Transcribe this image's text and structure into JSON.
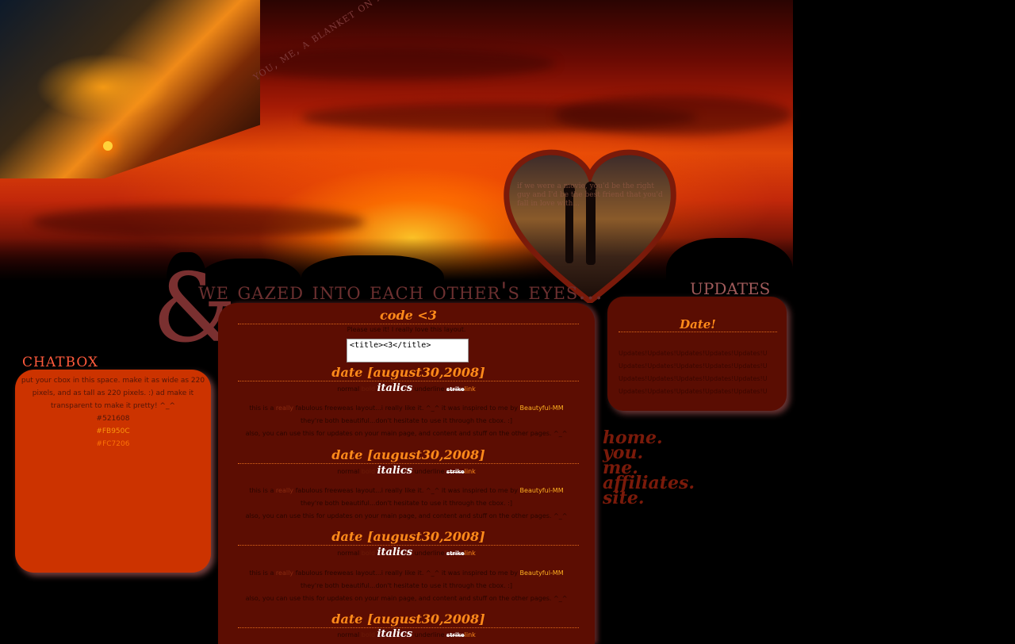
{
  "header": {
    "tagline": "you, me, a blanket on a beach...",
    "headline": "we gazed into each other's eyes...",
    "ampersand": "&",
    "heart_text": "if we were a movie, you'd be the right guy and I'd be the best friend that you'd fall in love with..."
  },
  "chatbox": {
    "title": "chatbox",
    "description": "put your cbox in this space. make it as wide as 220 pixels, and as tall as 220 pixels. :) ad make it transparent to make it pretty! ^_^",
    "colors": [
      {
        "label": "#521608",
        "hex": "#521608"
      },
      {
        "label": "#FB950C",
        "hex": "#FB950C"
      },
      {
        "label": "#FC7206",
        "hex": "#FC7206"
      }
    ]
  },
  "main": {
    "code_heading": "code <3",
    "code_note": "Please use it! I really love this layout.",
    "code_value": "<title><3</title>",
    "entries": [
      {
        "date": "date [august30,2008]",
        "normal": "normal",
        "bold": "bold",
        "italics": "italics",
        "underline": "underline",
        "strike": "strike",
        "link": "link",
        "line1_pre": "this is a",
        "line1_dim": "really",
        "line1_mid": "fabulous freeweas layout...i really like it. ^_^ it was inspired to me by",
        "credit": "Beautyful-MM",
        "line2": "they're both beautiful...don't hesitate to use it through the cbox. :]",
        "line3": "also, you can use this for updates on your main page, and content and stuff on the other pages. ^_^"
      },
      {
        "date": "date [august30,2008]",
        "normal": "normal",
        "bold": "bold",
        "italics": "italics",
        "underline": "underline",
        "strike": "strike",
        "link": "link",
        "line1_pre": "this is a",
        "line1_dim": "really",
        "line1_mid": "fabulous freeweas layout...i really like it. ^_^ it was inspired to me by",
        "credit": "Beautyful-MM",
        "line2": "they're both beautiful...don't hesitate to use it through the cbox. :]",
        "line3": "also, you can use this for updates on your main page, and content and stuff on the other pages. ^_^"
      },
      {
        "date": "date [august30,2008]",
        "normal": "normal",
        "bold": "bold",
        "italics": "italics",
        "underline": "underline",
        "strike": "strike",
        "link": "link",
        "line1_pre": "this is a",
        "line1_dim": "really",
        "line1_mid": "fabulous freeweas layout...i really like it. ^_^ it was inspired to me by",
        "credit": "Beautyful-MM",
        "line2": "they're both beautiful...don't hesitate to use it through the cbox. :]",
        "line3": "also, you can use this for updates on your main page, and content and stuff on the other pages. ^_^"
      },
      {
        "date": "date [august30,2008]",
        "normal": "normal",
        "bold": "bold",
        "italics": "italics",
        "underline": "underline",
        "strike": "strike",
        "link": "link"
      }
    ]
  },
  "updates": {
    "title": "updates",
    "date": "Date!",
    "lines": [
      "Updates!Updates!Updates!Updates!Updates!U",
      "Updates!Updates!Updates!Updates!Updates!U",
      "Updates!Updates!Updates!Updates!Updates!U",
      "Updates!Updates!Updates!Updates!Updates!U"
    ]
  },
  "nav": {
    "items": [
      "home.",
      "you.",
      "me.",
      "affiliates.",
      "site."
    ]
  }
}
